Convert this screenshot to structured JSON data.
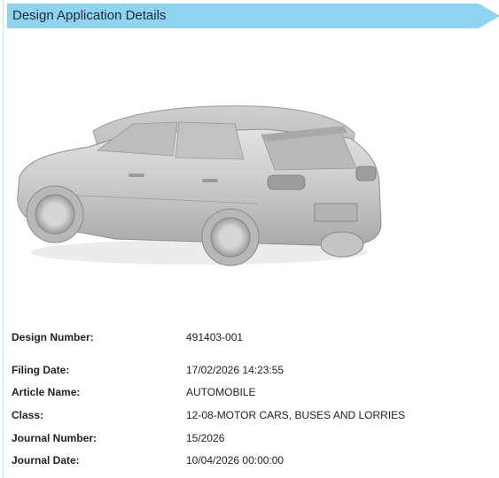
{
  "header": {
    "title": "Design Application Details"
  },
  "image": {
    "icon": "car-design-drawing"
  },
  "details": [
    {
      "label": "Design Number:",
      "value": "491403-001"
    },
    {
      "label": "Filing Date:",
      "value": "17/02/2026 14:23:55"
    },
    {
      "label": "Article Name:",
      "value": "AUTOMOBILE"
    },
    {
      "label": "Class:",
      "value": "12-08-MOTOR CARS, BUSES AND LORRIES"
    },
    {
      "label": "Journal Number:",
      "value": "15/2026"
    },
    {
      "label": "Journal Date:",
      "value": "10/04/2026 00:00:00"
    }
  ],
  "colors": {
    "header_bg": "#8fd3f2",
    "text": "#222222"
  }
}
